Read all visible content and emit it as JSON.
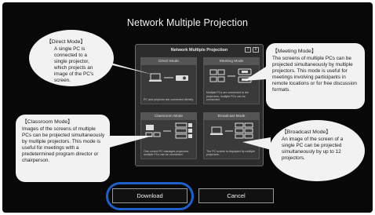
{
  "screen": {
    "title": "Network Multiple Projection"
  },
  "dialog": {
    "title": "Network Multiple Projection",
    "help_button": "?",
    "close_button": "x",
    "modes": [
      {
        "label": "Direct Mode",
        "desc": "PC and projector are connected directly."
      },
      {
        "label": "Meeting Mode",
        "desc": "Multiple PCs are connected to the projectors, multiple PCs can be connected."
      },
      {
        "label": "Classroom Mode",
        "desc": "One control PC manages projectors, multiple PCs can be connected."
      },
      {
        "label": "Broadcast Mode",
        "desc": "The PC screen is displayed by multiple projectors."
      }
    ]
  },
  "callouts": {
    "direct": {
      "title": "【Direct Mode】",
      "body": "A single PC is connected to a single projector, which projects an image of the PC's screen."
    },
    "meeting": {
      "title": "【Meeting Mode】",
      "body": "The screens of multiple PCs can be projected simultaneously by multiple projectors. This mode is useful for meetings involving participants in remote locations or for free discussion formats."
    },
    "classroom": {
      "title": "【Classroom Mode】",
      "body": "Images of the screens of multiple PCs can be projected simultaneously by multiple projectors. This mode is useful for meetings with a predetermined program director or chairperson."
    },
    "broadcast": {
      "title": "【Broadcast Mode】",
      "body": "An image of the screen of a single PC can be projected simultaneously by up to 12 projectors."
    }
  },
  "buttons": {
    "download": "Download",
    "cancel": "Cancel"
  },
  "colors": {
    "background": "#080808",
    "highlight_ring": "#1e5fc9"
  }
}
